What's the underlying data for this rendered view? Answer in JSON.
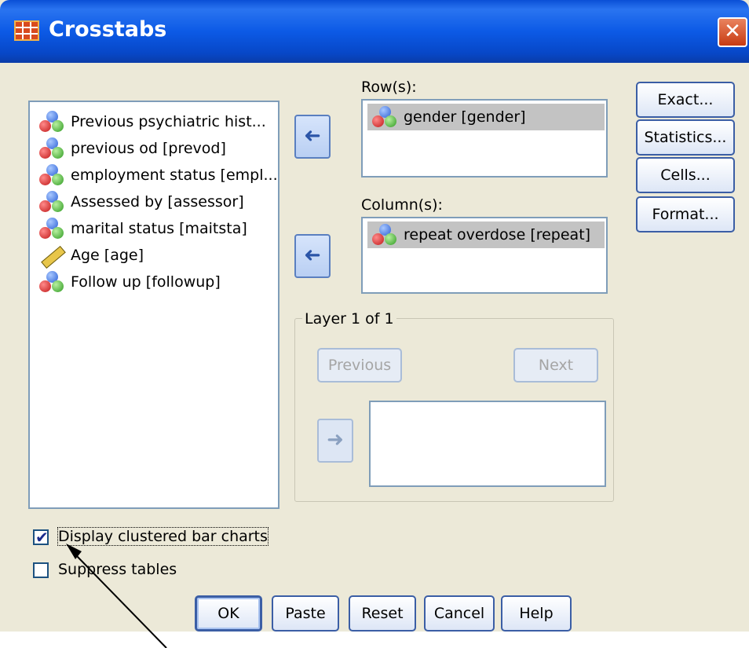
{
  "window": {
    "title": "Crosstabs",
    "close_glyph": "✕"
  },
  "variables": [
    {
      "label": "Previous psychiatric hist...",
      "icon": "nominal-icon"
    },
    {
      "label": "previous od  [prevod]",
      "icon": "nominal-icon"
    },
    {
      "label": "employment status [empl...",
      "icon": "nominal-icon"
    },
    {
      "label": "Assessed by [assessor]",
      "icon": "nominal-icon"
    },
    {
      "label": "marital status [maitsta]",
      "icon": "nominal-icon"
    },
    {
      "label": "Age [age]",
      "icon": "scale-icon"
    },
    {
      "label": "Follow up [followup]",
      "icon": "nominal-icon"
    }
  ],
  "rows": {
    "label": "Row(s):",
    "items": [
      "gender [gender]"
    ]
  },
  "columns": {
    "label": "Column(s):",
    "items": [
      "repeat overdose [repeat]"
    ]
  },
  "layer": {
    "label": "Layer 1 of 1",
    "previous": "Previous",
    "next": "Next"
  },
  "side_buttons": {
    "exact": "Exact...",
    "statistics": "Statistics...",
    "cells": "Cells...",
    "format": "Format..."
  },
  "options": {
    "clustered_label": "Display clustered bar charts",
    "clustered_checked": true,
    "suppress_label": "Suppress tables",
    "suppress_checked": false
  },
  "footer": {
    "ok": "OK",
    "paste": "Paste",
    "reset": "Reset",
    "cancel": "Cancel",
    "help": "Help"
  },
  "glyphs": {
    "arrow_left": "➜",
    "check": "✔"
  }
}
